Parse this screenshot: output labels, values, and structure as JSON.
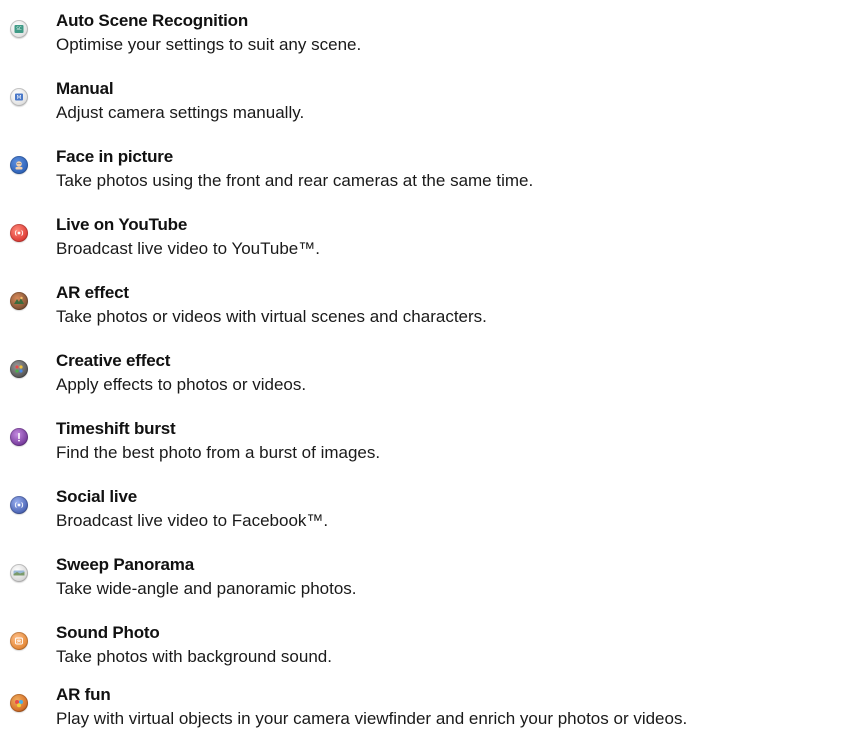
{
  "items": [
    {
      "icon": "auto-scene-recognition-icon",
      "title": "Auto Scene Recognition",
      "description": "Optimise your settings to suit any scene."
    },
    {
      "icon": "manual-mode-icon",
      "title": "Manual",
      "description": "Adjust camera settings manually."
    },
    {
      "icon": "face-in-picture-icon",
      "title": "Face in picture",
      "description": "Take photos using the front and rear cameras at the same time."
    },
    {
      "icon": "live-on-youtube-icon",
      "title": "Live on YouTube",
      "description": "Broadcast live video to YouTube™."
    },
    {
      "icon": "ar-effect-icon",
      "title": "AR effect",
      "description": "Take photos or videos with virtual scenes and characters."
    },
    {
      "icon": "creative-effect-icon",
      "title": "Creative effect",
      "description": "Apply effects to photos or videos."
    },
    {
      "icon": "timeshift-burst-icon",
      "title": "Timeshift burst",
      "description": "Find the best photo from a burst of images."
    },
    {
      "icon": "social-live-icon",
      "title": "Social live",
      "description": "Broadcast live video to Facebook™."
    },
    {
      "icon": "sweep-panorama-icon",
      "title": "Sweep Panorama",
      "description": "Take wide-angle and panoramic photos."
    },
    {
      "icon": "sound-photo-icon",
      "title": "Sound Photo",
      "description": "Take photos with background sound."
    },
    {
      "icon": "ar-fun-icon",
      "title": "AR fun",
      "description": "Play with virtual objects in your camera viewfinder and enrich your photos or videos."
    }
  ],
  "icon_colors": {
    "auto-scene-recognition-icon": "#3f9a86",
    "manual-mode-icon": "#4a78c8",
    "face-in-picture-icon": "#2f63b8",
    "live-on-youtube-icon": "#e0403a",
    "ar-effect-icon": "#8a5a3a",
    "creative-effect-icon": "#5a5a5a",
    "timeshift-burst-icon": "#7b3fa0",
    "social-live-icon": "#4f68b8",
    "sweep-panorama-icon": "#7a9a6a",
    "sound-photo-icon": "#e58a3a",
    "ar-fun-icon": "#d9732b"
  }
}
